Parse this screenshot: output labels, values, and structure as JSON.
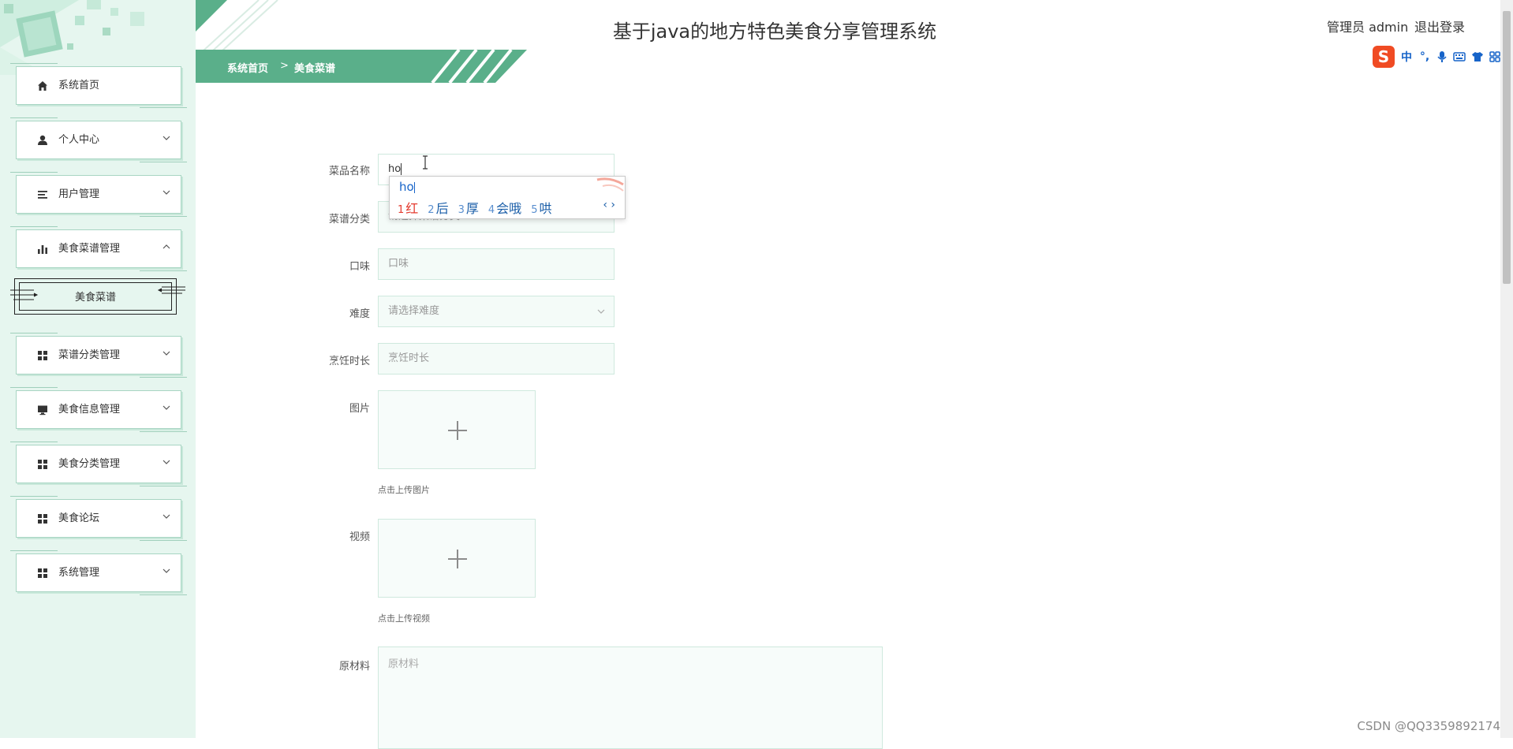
{
  "app": {
    "title": "基于java的地方特色美食分享管理系统",
    "user_label": "管理员 admin",
    "logout_label": "退出登录"
  },
  "ime_toolbar": {
    "logo": "S",
    "mode": "中",
    "punct": "°,"
  },
  "breadcrumb": {
    "home": "系统首页",
    "separator": ">",
    "current": "美食菜谱"
  },
  "sidebar": {
    "items": [
      {
        "label": "系统首页",
        "icon": "home-icon"
      },
      {
        "label": "个人中心",
        "icon": "person-icon"
      },
      {
        "label": "用户管理",
        "icon": "list-icon"
      },
      {
        "label": "美食菜谱管理",
        "icon": "bar-chart-icon",
        "expanded": true
      },
      {
        "label": "菜谱分类管理",
        "icon": "grid-icon"
      },
      {
        "label": "美食信息管理",
        "icon": "monitor-icon"
      },
      {
        "label": "美食分类管理",
        "icon": "grid-icon"
      },
      {
        "label": "美食论坛",
        "icon": "grid-icon"
      },
      {
        "label": "系统管理",
        "icon": "grid-icon"
      }
    ],
    "submenu": {
      "label": "美食菜谱"
    }
  },
  "form": {
    "name": {
      "label": "菜品名称",
      "value": "ho"
    },
    "category": {
      "label": "菜谱分类",
      "placeholder": "请选择菜谱分类"
    },
    "taste": {
      "label": "口味",
      "placeholder": "口味"
    },
    "difficulty": {
      "label": "难度",
      "placeholder": "请选择难度"
    },
    "cook_time": {
      "label": "烹饪时长",
      "placeholder": "烹饪时长"
    },
    "image": {
      "label": "图片",
      "hint": "点击上传图片"
    },
    "video": {
      "label": "视频",
      "hint": "点击上传视频"
    },
    "ingredients": {
      "label": "原材料",
      "placeholder": "原材料"
    }
  },
  "ime_popup": {
    "composition": "ho",
    "candidates": [
      {
        "num": "1",
        "text": "红"
      },
      {
        "num": "2",
        "text": "后"
      },
      {
        "num": "3",
        "text": "厚"
      },
      {
        "num": "4",
        "text": "会哦"
      },
      {
        "num": "5",
        "text": "哄"
      }
    ],
    "nav": "‹ ›"
  },
  "watermark": "CSDN @QQ3359892174",
  "colors": {
    "accent": "#5aaf8a",
    "sidebar_bg": "#e6f6ef",
    "ime_red": "#e43b2f",
    "ime_blue": "#1764c9"
  }
}
